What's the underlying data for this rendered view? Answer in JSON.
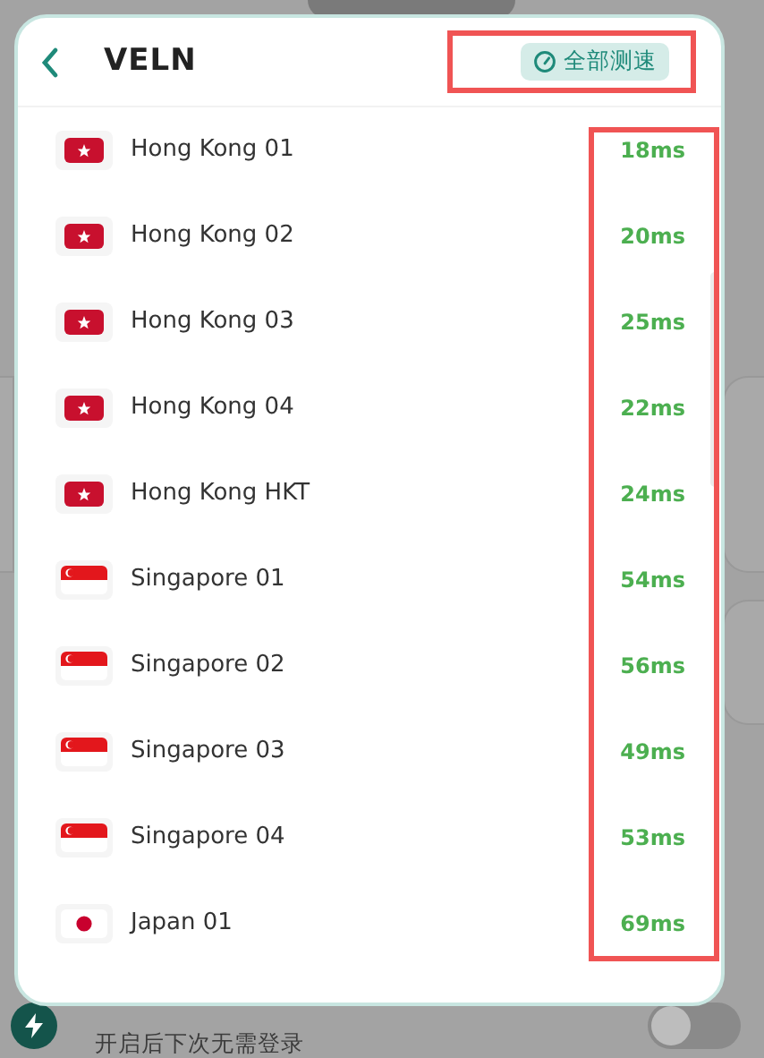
{
  "background": {
    "setting": {
      "subtitle": "开启后下次无需登录",
      "on": false
    }
  },
  "dialog": {
    "title": "VELN",
    "speed_test_button": {
      "label": "全部测速",
      "highlighted": true
    },
    "latency_column_highlighted": true,
    "nodes": [
      {
        "kind": "hk",
        "name": "Hong Kong 01",
        "latency": "18ms"
      },
      {
        "kind": "hk",
        "name": "Hong Kong 02",
        "latency": "20ms"
      },
      {
        "kind": "hk",
        "name": "Hong Kong 03",
        "latency": "25ms"
      },
      {
        "kind": "hk",
        "name": "Hong Kong 04",
        "latency": "22ms"
      },
      {
        "kind": "hk",
        "name": "Hong Kong HKT",
        "latency": "24ms"
      },
      {
        "kind": "sg",
        "name": "Singapore 01",
        "latency": "54ms"
      },
      {
        "kind": "sg",
        "name": "Singapore 02",
        "latency": "56ms"
      },
      {
        "kind": "sg",
        "name": "Singapore 03",
        "latency": "49ms"
      },
      {
        "kind": "sg",
        "name": "Singapore 04",
        "latency": "53ms"
      },
      {
        "kind": "jp",
        "name": "Japan 01",
        "latency": "69ms"
      }
    ]
  }
}
